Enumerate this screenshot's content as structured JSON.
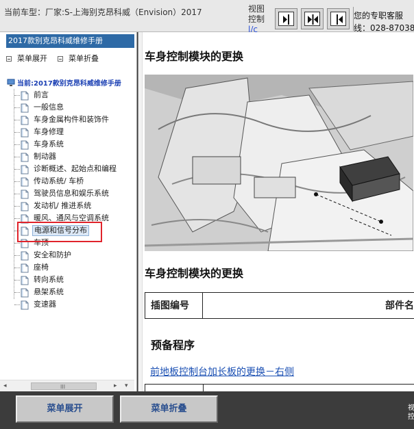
{
  "header": {
    "vehicle": "当前车型：厂家:S-上海别克昂科威（Envision）2017",
    "view_control": "视图控制",
    "view_control_cut": "l/c",
    "support_line1": "您的专职客服",
    "support_line2": "线：028-87038"
  },
  "sidebar": {
    "manual_title": "2017款别克昂科威维修手册",
    "expand_label": "菜单展开",
    "collapse_label": "菜单折叠",
    "current": "当前:2017款别克昂科威维修手册",
    "items": [
      {
        "label": "前言"
      },
      {
        "label": "一般信息"
      },
      {
        "label": "车身金属构件和装饰件"
      },
      {
        "label": "车身修理"
      },
      {
        "label": "车身系统"
      },
      {
        "label": "制动器"
      },
      {
        "label": "诊断概述、起始点和编程"
      },
      {
        "label": "传动系统/ 车桥"
      },
      {
        "label": "驾驶员信息和娱乐系统"
      },
      {
        "label": "发动机/ 推进系统"
      },
      {
        "label": "暖风、通风与空调系统"
      },
      {
        "label": "电源和信号分布"
      },
      {
        "label": "车顶"
      },
      {
        "label": "安全和防护"
      },
      {
        "label": "座椅"
      },
      {
        "label": "转向系统"
      },
      {
        "label": "悬架系统"
      },
      {
        "label": "变速器"
      }
    ],
    "selected_index": 11,
    "scroll_grip": "III"
  },
  "content": {
    "page_title": "车身控制模块的更换",
    "section_title": "车身控制模块的更换",
    "table_headers": [
      "插图编号",
      "部件名"
    ],
    "prep_title": "预备程序",
    "prep_link": "前地板控制台加长板的更换－右侧"
  },
  "footer": {
    "expand_label": "菜单展开",
    "collapse_label": "菜单折叠",
    "side_label": "视控"
  },
  "colors": {
    "accent": "#2e6aa6",
    "highlight_box": "#e0232b",
    "link": "#1a4fb3",
    "bottom_bar": "#3c3c3c"
  }
}
